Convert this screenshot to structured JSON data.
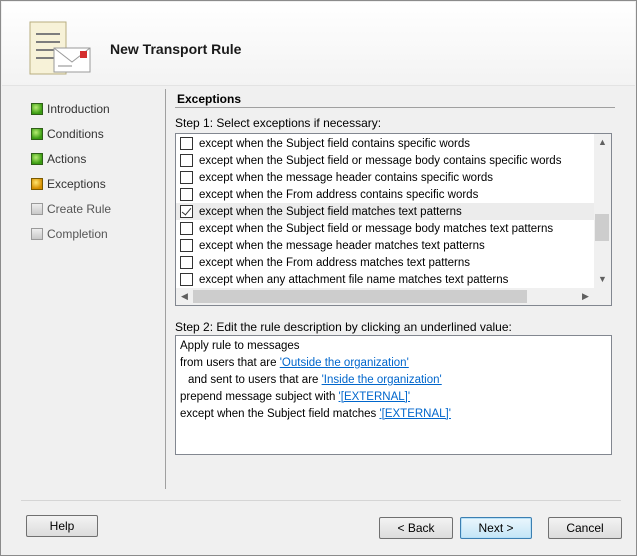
{
  "dialog": {
    "title": "New Transport Rule"
  },
  "nav": {
    "items": [
      {
        "label": "Introduction",
        "state": "complete"
      },
      {
        "label": "Conditions",
        "state": "complete"
      },
      {
        "label": "Actions",
        "state": "complete"
      },
      {
        "label": "Exceptions",
        "state": "current"
      },
      {
        "label": "Create Rule",
        "state": "pending"
      },
      {
        "label": "Completion",
        "state": "pending"
      }
    ]
  },
  "content": {
    "section_title": "Exceptions",
    "step1_label": "Step 1: Select exceptions if necessary:",
    "exceptions": [
      {
        "label": "except when the Subject field contains specific words",
        "checked": false
      },
      {
        "label": "except when the Subject field or message body contains specific words",
        "checked": false
      },
      {
        "label": "except when the message header contains specific words",
        "checked": false
      },
      {
        "label": "except when the From address contains specific words",
        "checked": false
      },
      {
        "label": "except when the Subject field matches text patterns",
        "checked": true
      },
      {
        "label": "except when the Subject field or message body matches text patterns",
        "checked": false
      },
      {
        "label": "except when the message header matches text patterns",
        "checked": false
      },
      {
        "label": "except when the From address matches text patterns",
        "checked": false
      },
      {
        "label": "except when any attachment file name matches text patterns",
        "checked": false
      }
    ],
    "step2_label": "Step 2: Edit the rule description by clicking an underlined value:",
    "description": {
      "line1": "Apply rule to messages",
      "line2_text": "from users that are ",
      "line2_link": "'Outside the organization'",
      "line3_text": "and sent to users that are ",
      "line3_link": "'Inside the organization'",
      "line4_text": "prepend message subject with ",
      "line4_link": "'[EXTERNAL]'",
      "line5_text": "except when the Subject field matches ",
      "line5_link": "'[EXTERNAL]'"
    }
  },
  "buttons": {
    "help": "Help",
    "back": "< Back",
    "next": "Next >",
    "cancel": "Cancel"
  },
  "colors": {
    "link": "#0066cc",
    "complete": "#3a9b12",
    "current": "#d58e00"
  }
}
